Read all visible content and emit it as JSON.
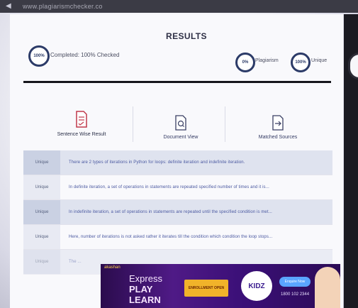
{
  "browser": {
    "back_icon": "back-icon",
    "url": "www.plagiarismchecker.co"
  },
  "results": {
    "title": "RESULTS",
    "completed_pct": "100%",
    "completed_label": "Completed: 100% Checked",
    "plagiarism_pct": "0%",
    "plagiarism_label": "Plagiarism",
    "unique_pct": "100%",
    "unique_label": "Unique"
  },
  "features": [
    {
      "label": "Sentence Wise Result",
      "icon": "document-lines-icon"
    },
    {
      "label": "Document View",
      "icon": "document-search-icon"
    },
    {
      "label": "Matched Sources",
      "icon": "document-arrow-icon"
    }
  ],
  "sentences": [
    {
      "tag": "Unique",
      "text": "There are 2 types of iterations in Python for loops: definite iteration and indefinite iteration."
    },
    {
      "tag": "Unique",
      "text": "In definite iteration, a set of operations in statements are repeated specified number of times and it is..."
    },
    {
      "tag": "Unique",
      "text": "In indefinite iteration, a set of operations in statements are repeated until the specified condition is met..."
    },
    {
      "tag": "Unique",
      "text": "Here, number of iterations is not asked rather it iterates till the condition which condition the loop stops..."
    },
    {
      "tag": "Unique",
      "text": "The ..."
    }
  ],
  "ad": {
    "label": "akashan",
    "line1": "Express",
    "line2": "PLAY",
    "line3": "LEARN",
    "banner": "ENROLLMENT OPEN",
    "logo": "KIDZ",
    "cta": "Enquire Now",
    "phone": "1800 102 2344"
  }
}
